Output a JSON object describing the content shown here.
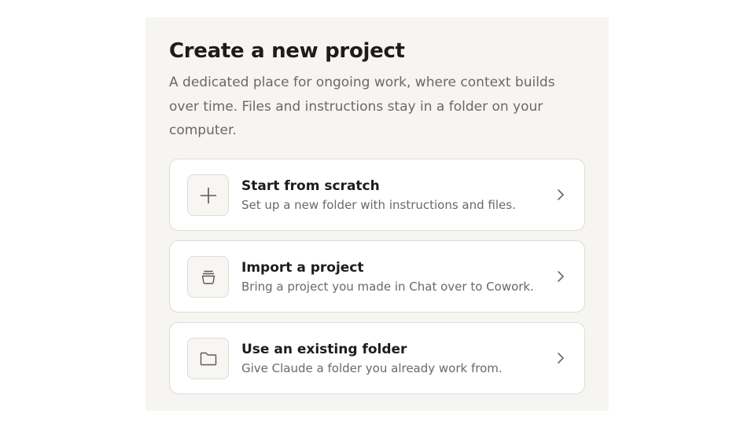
{
  "dialog": {
    "title": "Create a new project",
    "description": "A dedicated place for ongoing work, where context builds over time. Files and instructions stay in a folder on your computer."
  },
  "options": [
    {
      "title": "Start from scratch",
      "subtitle": "Set up a new folder with instructions and files.",
      "icon": "plus-icon"
    },
    {
      "title": "Import a project",
      "subtitle": "Bring a project you made in Chat over to Cowork.",
      "icon": "import-stack-icon"
    },
    {
      "title": "Use an existing folder",
      "subtitle": "Give Claude a folder you already work from.",
      "icon": "folder-icon"
    }
  ],
  "colors": {
    "panel_background": "#f6f5f2",
    "card_border": "#dedcd6",
    "text_primary": "#1d1c1a",
    "text_secondary": "#6b6965"
  }
}
